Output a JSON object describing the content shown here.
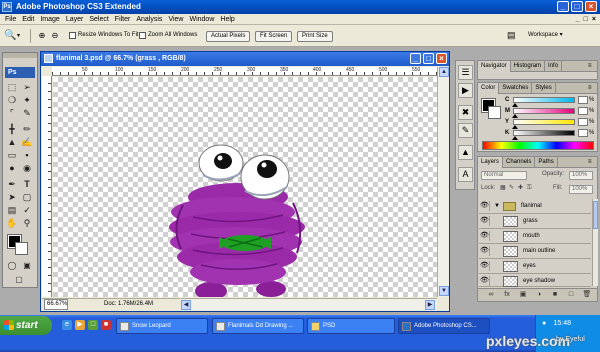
{
  "app": {
    "title": "Adobe Photoshop CS3 Extended",
    "logo": "Ps"
  },
  "menubar": {
    "items": [
      "File",
      "Edit",
      "Image",
      "Layer",
      "Select",
      "Filter",
      "Analysis",
      "View",
      "Window",
      "Help"
    ],
    "mdi_controls": [
      "_",
      "□",
      "×"
    ]
  },
  "options": {
    "resize_windows_label": "Resize Windows To Fit",
    "zoom_all_windows_label": "Zoom All Windows",
    "actual_pixels": "Actual Pixels",
    "fit_screen": "Fit Screen",
    "print_size": "Print Size",
    "workspace": "Workspace ▾"
  },
  "tools": {
    "logo": "Ps",
    "items": [
      "marquee",
      "move",
      "lasso",
      "magic-wand",
      "crop",
      "slice",
      "healing",
      "brush",
      "stamp",
      "history-brush",
      "eraser",
      "gradient",
      "dodge",
      "pen",
      "type",
      "path-select",
      "shape",
      "notes",
      "eyedropper",
      "hand",
      "zoom"
    ]
  },
  "document": {
    "title": "flanimal 3.psd @ 66.7% (grass , RGB/8)",
    "zoom": "66.67%",
    "doc_size": "Doc: 1.76M/26.4M",
    "ruler_numbers": [
      "50",
      "100",
      "150",
      "200",
      "250",
      "300",
      "350",
      "400",
      "450",
      "500",
      "550"
    ]
  },
  "panels": {
    "navigator_tabs": [
      "Navigator",
      "Histogram",
      "Info"
    ],
    "color_tabs": [
      "Color",
      "Swatches",
      "Styles"
    ],
    "color_channels": [
      {
        "label": "C",
        "value": "",
        "unit": "%",
        "color": "#00b7eb"
      },
      {
        "label": "M",
        "value": "",
        "unit": "%",
        "color": "#e4007c"
      },
      {
        "label": "Y",
        "value": "",
        "unit": "%",
        "color": "#ffe600"
      },
      {
        "label": "K",
        "value": "",
        "unit": "%",
        "color": "#000000"
      }
    ],
    "layers_tabs": [
      "Layers",
      "Channels",
      "Paths"
    ],
    "blend_mode": "Normal",
    "opacity_label": "Opacity:",
    "opacity": "100%",
    "lock_label": "Lock:",
    "fill_label": "Fill:",
    "fill": "100%",
    "layers": [
      {
        "name": "flanimal",
        "group": true
      },
      {
        "name": "grass",
        "group": false
      },
      {
        "name": "mouth",
        "group": false
      },
      {
        "name": "main outline",
        "group": false
      },
      {
        "name": "eyes",
        "group": false
      },
      {
        "name": "eye shadow",
        "group": false
      }
    ]
  },
  "taskbar": {
    "start": "start",
    "tasks": [
      {
        "label": "Snow Leopard",
        "active": false
      },
      {
        "label": "Flanimals Dd Drawing ...",
        "active": false
      },
      {
        "label": "PSD",
        "active": false
      },
      {
        "label": "Adobe Photoshop CS...",
        "active": true
      }
    ],
    "clock": "15:48"
  },
  "watermark": "pxleyes.com",
  "watermark_user": "by Eyeful",
  "colors": {
    "creature_body": "#9a2aa8",
    "creature_shadow": "#6e1580",
    "mouth_grass": "#1fa025",
    "xp_blue": "#245edb"
  }
}
